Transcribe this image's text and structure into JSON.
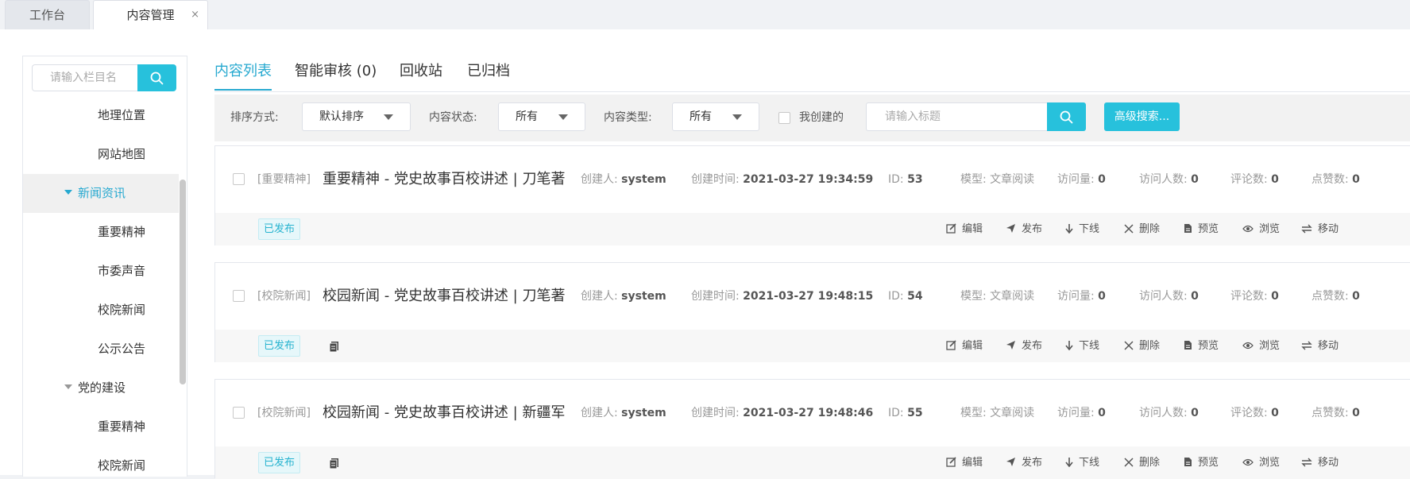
{
  "window_tabs": [
    {
      "label": "工作台"
    },
    {
      "label": "内容管理",
      "close": "×"
    }
  ],
  "sidebar": {
    "search_placeholder": "请输入栏目名",
    "items": [
      {
        "label": "地理位置"
      },
      {
        "label": "网站地图"
      },
      {
        "label": "新闻资讯",
        "expanded": true,
        "active": true
      },
      {
        "label": "重要精神"
      },
      {
        "label": "市委声音"
      },
      {
        "label": "校院新闻"
      },
      {
        "label": "公示公告"
      },
      {
        "label": "党的建设",
        "expanded": true
      },
      {
        "label": "重要精神"
      },
      {
        "label": "校院新闻"
      }
    ]
  },
  "main_tabs": [
    {
      "label": "内容列表",
      "active": true
    },
    {
      "label": "智能审核 (0)"
    },
    {
      "label": "回收站"
    },
    {
      "label": "已归档"
    }
  ],
  "filters": {
    "sort_label": "排序方式:",
    "sort_value": "默认排序",
    "status_label": "内容状态:",
    "status_value": "所有",
    "type_label": "内容类型:",
    "type_value": "所有",
    "mine_label": "我创建的",
    "title_placeholder": "请输入标题",
    "advanced_label": "高级搜索..."
  },
  "meta_labels": {
    "creator": "创建人:",
    "created_at": "创建时间:",
    "id": "ID:",
    "model": "模型:",
    "views": "访问量:",
    "visitors": "访问人数:",
    "comments": "评论数:",
    "likes": "点赞数:"
  },
  "actions": [
    {
      "label": "编辑",
      "icon": "edit-icon"
    },
    {
      "label": "发布",
      "icon": "send-icon"
    },
    {
      "label": "下线",
      "icon": "arrow-down-icon"
    },
    {
      "label": "删除",
      "icon": "close-icon"
    },
    {
      "label": "预览",
      "icon": "file-icon"
    },
    {
      "label": "浏览",
      "icon": "eye-icon"
    },
    {
      "label": "移动",
      "icon": "swap-icon"
    }
  ],
  "more_label": "···",
  "items": [
    {
      "category": "[重要精神]",
      "title": "重要精神 - 党史故事百校讲述 | 刀笔著...",
      "creator": "system",
      "created_at": "2021-03-27 19:34:59",
      "id": "53",
      "model": "文章阅读",
      "views": "0",
      "visitors": "0",
      "comments": "0",
      "likes": "0",
      "status": "已发布",
      "has_doc_icon": false
    },
    {
      "category": "[校院新闻]",
      "title": "校园新闻 - 党史故事百校讲述 | 刀笔著...",
      "creator": "system",
      "created_at": "2021-03-27 19:48:15",
      "id": "54",
      "model": "文章阅读",
      "views": "0",
      "visitors": "0",
      "comments": "0",
      "likes": "0",
      "status": "已发布",
      "has_doc_icon": true
    },
    {
      "category": "[校院新闻]",
      "title": "校园新闻 - 党史故事百校讲述 | 新疆军...",
      "creator": "system",
      "created_at": "2021-03-27 19:48:46",
      "id": "55",
      "model": "文章阅读",
      "views": "0",
      "visitors": "0",
      "comments": "0",
      "likes": "0",
      "status": "已发布",
      "has_doc_icon": true
    }
  ],
  "colors": {
    "accent": "#27c1dc",
    "active_text": "#27a9d0"
  }
}
